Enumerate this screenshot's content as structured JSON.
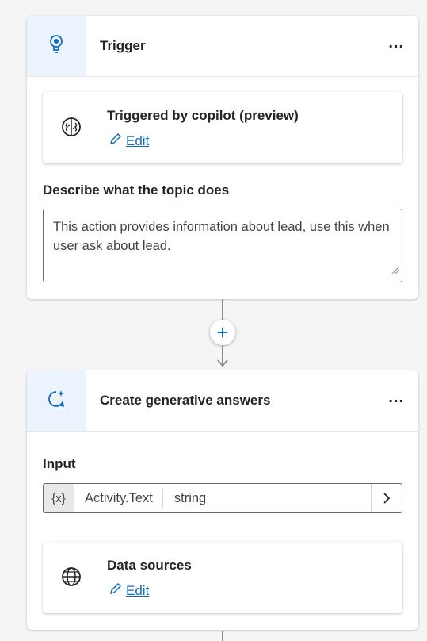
{
  "trigger_card": {
    "title": "Trigger",
    "more_label": "...",
    "triggered_by": {
      "title": "Triggered by copilot (preview)",
      "edit_label": "Edit"
    },
    "describe_label": "Describe what the topic does",
    "description": "This action provides information about lead, use this when user ask about lead."
  },
  "connector": {
    "add_label": "+"
  },
  "gen_card": {
    "title": "Create generative answers",
    "more_label": "...",
    "input_label": "Input",
    "input": {
      "var_icon": "{x}",
      "var_name": "Activity.Text",
      "var_type": "string"
    },
    "data_sources": {
      "title": "Data sources",
      "edit_label": "Edit"
    }
  },
  "colors": {
    "accent": "#0f6cbd",
    "icon_bg": "#ebf3fc"
  },
  "icons": {
    "trigger": "lightbulb-icon",
    "copilot": "brain-icon",
    "generative": "sparkle-chat-icon",
    "globe": "globe-icon",
    "edit": "pencil-icon",
    "chevron": "chevron-right-icon"
  }
}
